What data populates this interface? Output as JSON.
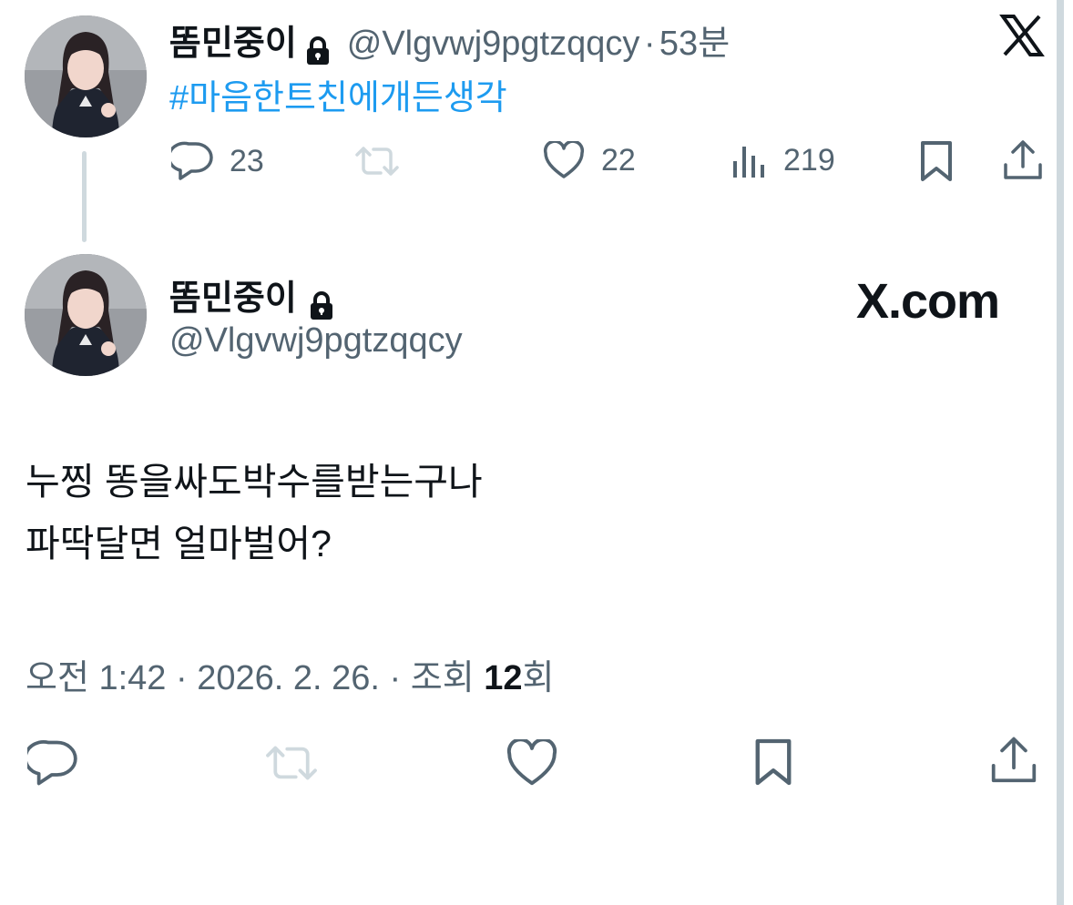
{
  "top_tweet": {
    "display_name": "똠민중이",
    "handle": "@Vlgvwj9pgtzqqcy",
    "separator": "·",
    "time_ago": "53분",
    "hashtag": "#마음한트친에개든생각",
    "stats": {
      "replies": "23",
      "likes": "22",
      "views": "219"
    },
    "icons": [
      "lock-icon",
      "x-logo-icon",
      "reply-icon",
      "retweet-icon",
      "like-icon",
      "views-icon",
      "bookmark-icon",
      "share-icon"
    ]
  },
  "main_tweet": {
    "display_name": "똠민중이",
    "handle": "@Vlgvwj9pgtzqqcy",
    "brand": "X.com",
    "text_lines": [
      "누찡 똥을싸도박수를받는구나",
      "파딱달면 얼마벌어?"
    ],
    "meta": {
      "time": "오전 1:42",
      "dot1": "·",
      "date": "2026. 2. 26.",
      "dot2": "·",
      "views_label": "조회",
      "views_count": "12",
      "views_unit": "회"
    },
    "icons": [
      "reply-icon",
      "retweet-icon",
      "like-icon",
      "bookmark-icon",
      "share-icon"
    ]
  },
  "colors": {
    "text": "#0f1419",
    "secondary": "#536471",
    "link": "#1d9bf0",
    "disabled_icon": "#cfd9de",
    "divider": "#cfd9de"
  }
}
